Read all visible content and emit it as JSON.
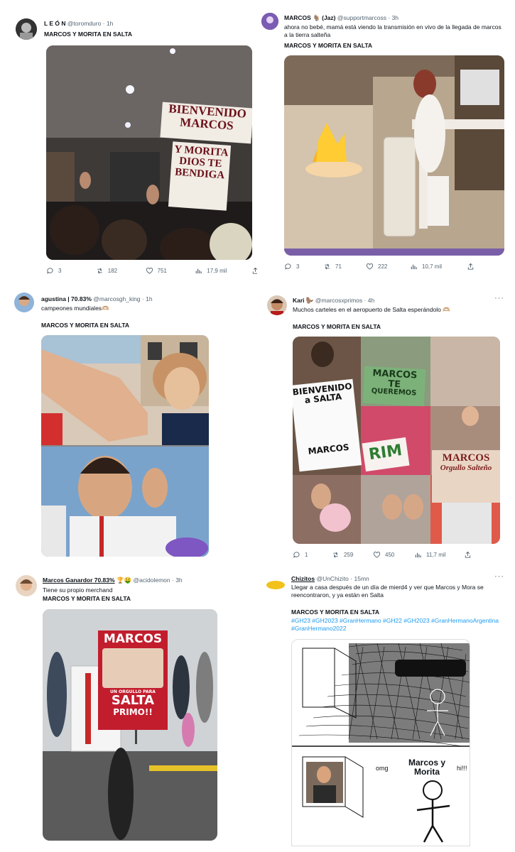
{
  "colors": {
    "text": "#0f1419",
    "secondary": "#536471",
    "link": "#1d9bf0",
    "divider": "#e6ecf0"
  },
  "tweets": [
    {
      "name": "L E Ó N",
      "handle": "@toromduro",
      "time": "1h",
      "text": "",
      "title": "MARCOS Y MORITA EN SALTA",
      "media": {
        "sign_lines": [
          "BIENVENIDO",
          "MARCOS",
          "Y MORITA",
          "DIOS TE",
          "BENDIGA"
        ]
      },
      "stats": {
        "replies": "3",
        "retweets": "182",
        "likes": "751",
        "views": "17,9 mil"
      }
    },
    {
      "name": "MARCOS",
      "name_emoji": "🐐",
      "sub_name": "(Jaz)",
      "handle": "@supportmarcoss",
      "time": "3h",
      "text": "ahora no bebé, mamá está viendo la transmisión en vivo de la llegada de marcos a la tierra salteña",
      "title": "MARCOS Y MORITA EN SALTA",
      "stats": {
        "replies": "3",
        "retweets": "71",
        "likes": "222",
        "views": "10,7 mil"
      }
    },
    {
      "name": "agustina | 70.83%",
      "handle": "@marcosgh_king",
      "time": "1h",
      "text": "campeones mundiales🫶🏼",
      "title": "MARCOS Y MORITA EN SALTA",
      "stats": {}
    },
    {
      "name": "Kari",
      "name_emoji": "🦫",
      "handle": "@marcosxprimos",
      "time": "4h",
      "text": "Muchos carteles en el aeropuerto de Salta esperándolo 🫶🏼",
      "title": "MARCOS Y MORITA EN SALTA",
      "media": {
        "sign_a": [
          "BIENVENIDO",
          "a SALTA",
          "MARCOS"
        ],
        "sign_b": [
          "MARCOS",
          "TE",
          "QUEREMOS"
        ],
        "sign_c": "RIM",
        "sign_d": [
          "MARCOS",
          "Orgullo Salteño"
        ]
      },
      "stats": {
        "replies": "1",
        "retweets": "259",
        "likes": "450",
        "views": "11,7 mil"
      }
    },
    {
      "name": "Marcos Ganardor 70.83%",
      "name_emoji": "🏆🤑",
      "handle": "@acidolemon",
      "time": "3h",
      "text": "Tiene su propio merchand",
      "title": "MARCOS Y MORITA EN SALTA",
      "media": {
        "merch_lines": [
          "MARCOS",
          "UN ORGULLO PARA",
          "SALTA",
          "PRIMO!!"
        ]
      },
      "stats": {}
    },
    {
      "name": "Chizitos",
      "handle": "@UnChizito",
      "time": "15mn",
      "text": "Llegar a casa después de un día de mierd4 y ver que Marcos y Mora se reencontraron, y ya están en Salta",
      "title": "MARCOS Y MORITA EN SALTA",
      "hashtags": "#GH23 #GH2023 #GranHermano #GH22 #GH2023 #GranHermanoArgentina #GranHermano2022",
      "media": {
        "omg": "omg",
        "caption": "Marcos y Morita",
        "hi": "hi!!!"
      },
      "stats": {}
    }
  ]
}
